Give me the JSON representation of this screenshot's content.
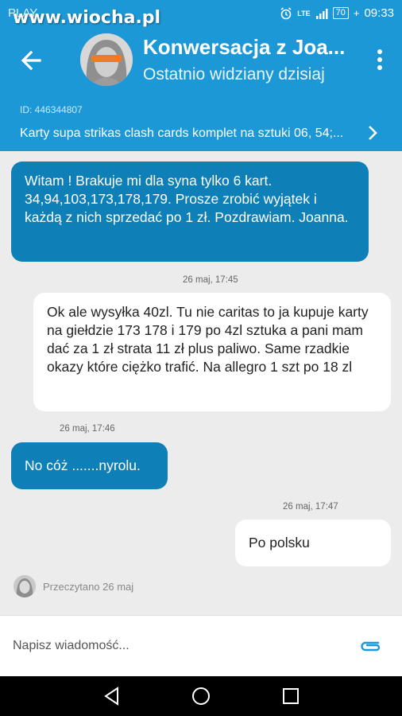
{
  "status_bar": {
    "carrier": "PLAY",
    "watermark": "www.wiocha.pl",
    "network": "LTE",
    "battery": "70",
    "time": "09:33"
  },
  "header": {
    "title": "Konwersacja z Joa...",
    "subtitle": "Ostatnio widziany dzisiaj",
    "back_icon": "arrow-left-icon",
    "menu_icon": "more-vert-icon"
  },
  "listing": {
    "id_text": "ID: 446344807",
    "title": "Karty supa strikas clash cards komplet na sztuki 06, 54;..."
  },
  "messages": [
    {
      "direction": "incoming",
      "text": "Witam ! Brakuje mi dla syna tylko 6 kart. 34,94,103,173,178,179. Prosze zrobić wyjątek i każdą z nich sprzedać po 1 zł. Pozdrawiam. Joanna."
    },
    {
      "direction": "outgoing",
      "timestamp": "26 maj, 17:45",
      "text": "Ok ale wysyłka 40zl. Tu nie caritas to ja kupuje karty na giełdzie 173 178 i 179 po 4zl sztuka a pani mam dać za 1 zł strata 11 zł plus paliwo. Same rzadkie okazy które ciężko trafić. Na allegro 1 szt po 18 zl"
    },
    {
      "direction": "incoming",
      "timestamp": "26 maj, 17:46",
      "text": "No cóż .......nyrolu."
    },
    {
      "direction": "outgoing",
      "timestamp": "26 maj, 17:47",
      "text": "Po polsku"
    }
  ],
  "read_receipt": "Przeczytano 26 maj",
  "composer": {
    "placeholder": "Napisz wiadomość..."
  },
  "colors": {
    "primary": "#1d98d6",
    "incoming_bubble": "#0f7fb8",
    "outgoing_bubble": "#ffffff",
    "attach_icon": "#1d98d6"
  }
}
